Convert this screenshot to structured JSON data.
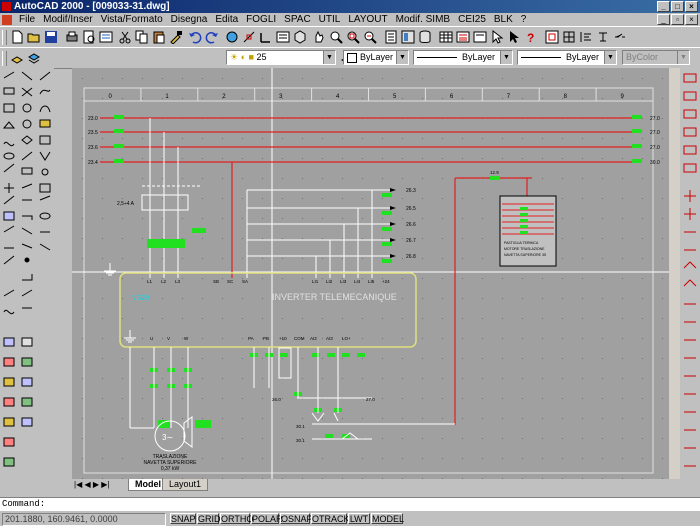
{
  "window": {
    "title": "AutoCAD 2000 - [009033-31.dwg]",
    "buttons": [
      "_",
      "□",
      "×"
    ]
  },
  "menu": [
    "File",
    "Modif/Inser",
    "Vista/Formato",
    "Disegna",
    "Edita",
    "FOGLI",
    "SPAC",
    "UTIL",
    "LAYOUT",
    "Modif. SIMB",
    "CEI25",
    "BLK",
    "?"
  ],
  "toolbar2": {
    "layer_value": "25",
    "color_value": "ByLayer",
    "linetype_value": "ByLayer",
    "lineweight_value": "ByLayer",
    "plotstyle_value": "ByColor"
  },
  "drawing": {
    "column_numbers": [
      "0",
      "1",
      "2",
      "3",
      "4",
      "5",
      "6",
      "7",
      "8",
      "9"
    ],
    "line_labels_left": [
      "23.0",
      "23.5",
      "23.6",
      "23.4"
    ],
    "line_labels_right": [
      "27.0",
      "27.0",
      "27.0",
      "30.0"
    ],
    "branch_labels": [
      "26.3",
      "26.5",
      "26.6",
      "26.7",
      "26.8"
    ],
    "breaker_label": "2,5÷4 A",
    "inverter_title": "INVERTER TELEMECANIQUE",
    "inverter_ref": "VS29",
    "top_terminals": [
      "L1",
      "L2",
      "L3",
      "SB",
      "SC",
      "SA",
      "LI1",
      "LI2",
      "LI3",
      "LI4",
      "LI5",
      "+24"
    ],
    "bottom_terminals": [
      "U",
      "V",
      "W",
      "PA",
      "PB",
      "+10",
      "COM",
      "AI2",
      "AI3",
      "LO+"
    ],
    "motor_symbol": "3∼",
    "motor_caption": [
      "TRASLAZIONE",
      "NAVETTA SUPERIORE",
      "0,37 kW"
    ],
    "legend_box": [
      "PASTIGLIA TERMICA",
      "MOTORE TRASLAZIONE",
      "NAVETTA SUPERIORE 3S"
    ],
    "other_labels": [
      "30.1",
      "30.1",
      "27.0",
      "26.0",
      "12.9"
    ]
  },
  "tabs": {
    "model": "Model",
    "layout1": "Layout1"
  },
  "command": {
    "prompt": "Command:"
  },
  "status": {
    "coords": "201.1880, 160.9461, 0.0000",
    "toggles": [
      "SNAP",
      "GRID",
      "ORTHO",
      "POLAR",
      "OSNAP",
      "OTRACK",
      "LWT",
      "MODEL"
    ]
  },
  "colors": {
    "canvas": "#a0a0a0",
    "title_gradient": "#0a246a",
    "red_line": "#e02020",
    "green_label": "#20e020",
    "yellow_frame": "#e0e080",
    "cyan_text": "#20d0e0"
  }
}
